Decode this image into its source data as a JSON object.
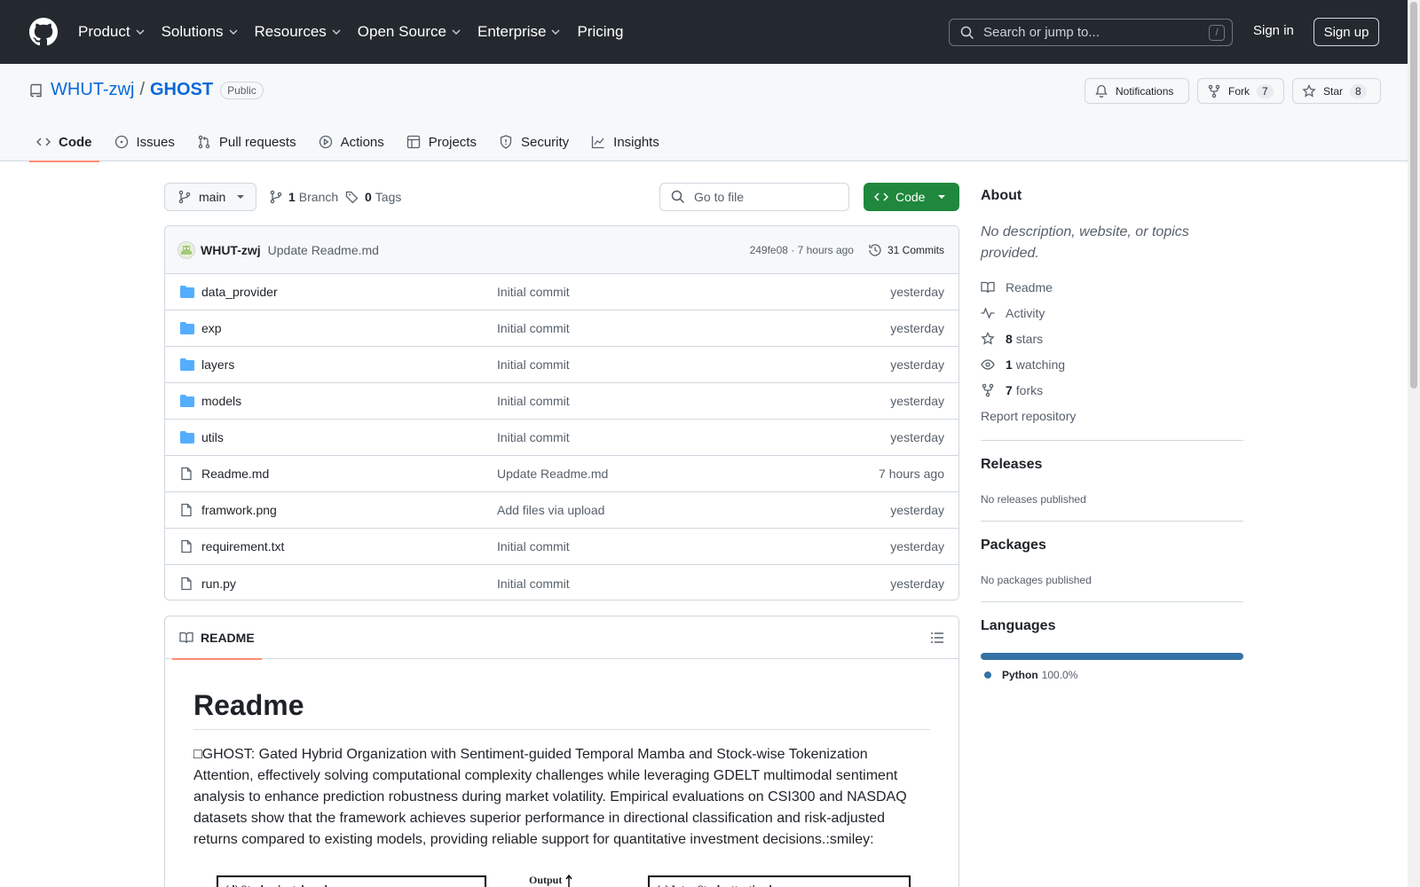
{
  "header": {
    "nav": [
      {
        "label": "Product",
        "dropdown": true
      },
      {
        "label": "Solutions",
        "dropdown": true
      },
      {
        "label": "Resources",
        "dropdown": true
      },
      {
        "label": "Open Source",
        "dropdown": true
      },
      {
        "label": "Enterprise",
        "dropdown": true
      },
      {
        "label": "Pricing",
        "dropdown": false
      }
    ],
    "search_placeholder": "Search or jump to...",
    "search_shortcut": "/",
    "signin": "Sign in",
    "signup": "Sign up"
  },
  "repo": {
    "owner": "WHUT-zwj",
    "separator": "/",
    "name": "GHOST",
    "visibility": "Public",
    "notifications_label": "Notifications",
    "fork_label": "Fork",
    "fork_count": "7",
    "star_label": "Star",
    "star_count": "8",
    "tabs": [
      "Code",
      "Issues",
      "Pull requests",
      "Actions",
      "Projects",
      "Security",
      "Insights"
    ]
  },
  "toolbar": {
    "branch": "main",
    "branch_count": "1",
    "branch_label": "Branch",
    "tag_count": "0",
    "tag_label": "Tags",
    "goto_placeholder": "Go to file",
    "code_label": "Code"
  },
  "latest_commit": {
    "author": "WHUT-zwj",
    "message": "Update Readme.md",
    "hash_time": "249fe08 · 7 hours ago",
    "commits": "31 Commits"
  },
  "files": [
    {
      "type": "folder",
      "name": "data_provider",
      "commit": "Initial commit",
      "date": "yesterday"
    },
    {
      "type": "folder",
      "name": "exp",
      "commit": "Initial commit",
      "date": "yesterday"
    },
    {
      "type": "folder",
      "name": "layers",
      "commit": "Initial commit",
      "date": "yesterday"
    },
    {
      "type": "folder",
      "name": "models",
      "commit": "Initial commit",
      "date": "yesterday"
    },
    {
      "type": "folder",
      "name": "utils",
      "commit": "Initial commit",
      "date": "yesterday"
    },
    {
      "type": "file",
      "name": "Readme.md",
      "commit": "Update Readme.md",
      "date": "7 hours ago"
    },
    {
      "type": "file",
      "name": "framwork.png",
      "commit": "Add files via upload",
      "date": "yesterday"
    },
    {
      "type": "file",
      "name": "requirement.txt",
      "commit": "Initial commit",
      "date": "yesterday"
    },
    {
      "type": "file",
      "name": "run.py",
      "commit": "Initial commit",
      "date": "yesterday"
    }
  ],
  "readme": {
    "tab_label": "README",
    "heading": "Readme",
    "paragraph": "□GHOST: Gated Hybrid Organization with Sentiment-guided Temporal Mamba and Stock-wise Tokenization Attention, effectively solving computational complexity challenges while leveraging GDELT multimodal sentiment analysis to enhance prediction robustness during market volatility. Empirical evaluations on CSI300 and NASDAQ datasets show that the framework achieves superior performance in directional classification and risk-adjusted returns compared to existing models, providing reliable support for quantitative investment decisions.:smiley:",
    "figure_labels": {
      "left": "(d)  Stock-wise tokens layer",
      "middle": "Output",
      "right": "(e)  Inter-Stock attention layer"
    }
  },
  "sidebar": {
    "about_title": "About",
    "about_desc": "No description, website, or topics provided.",
    "readme_link": "Readme",
    "activity_link": "Activity",
    "stars_count": "8",
    "stars_label": "stars",
    "watching_count": "1",
    "watching_label": "watching",
    "forks_count": "7",
    "forks_label": "forks",
    "report": "Report repository",
    "releases_title": "Releases",
    "releases_text": "No releases published",
    "packages_title": "Packages",
    "packages_text": "No packages published",
    "languages_title": "Languages",
    "language": {
      "name": "Python",
      "percent": "100.0%",
      "color": "#3572A5",
      "share": 100.0
    }
  }
}
